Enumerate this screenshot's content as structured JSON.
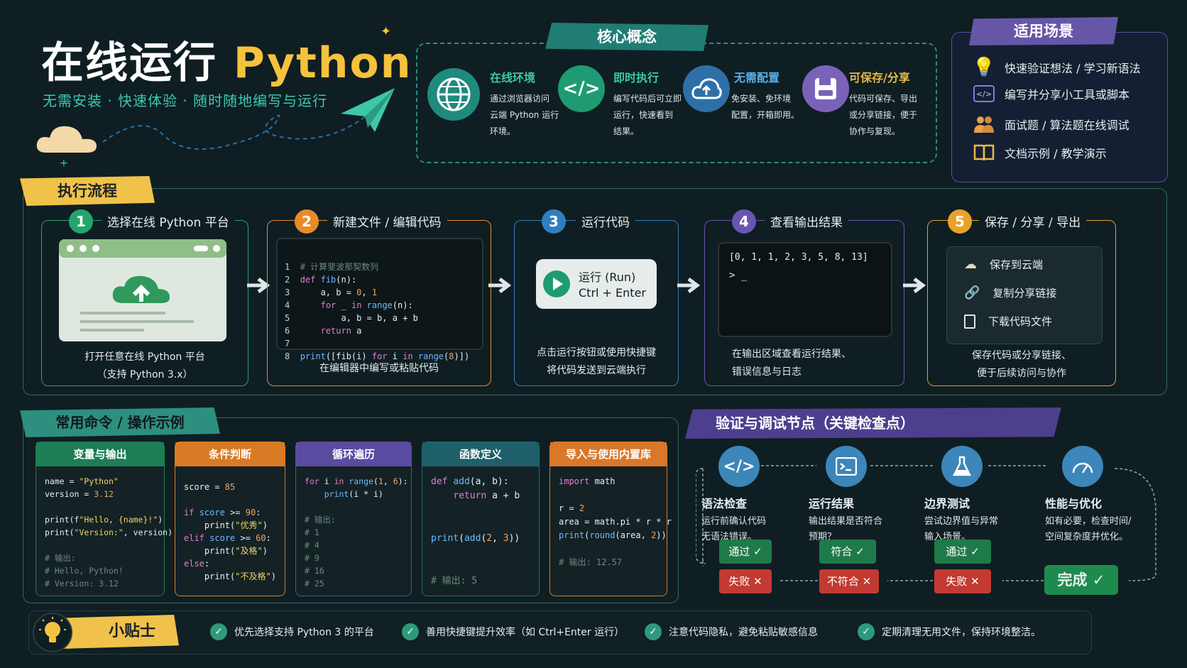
{
  "header": {
    "title_cn": "在线运行",
    "title_py": "Python",
    "subtitle": "无需安装 · 快速体验 · 随时随地编写与运行"
  },
  "concepts": {
    "banner": "核心概念",
    "items": [
      {
        "title": "在线环境",
        "desc": [
          "通过浏览器访问",
          "云端 Python 运行",
          "环境。"
        ],
        "icon": "globe-icon",
        "color": "#1f8a7e"
      },
      {
        "title": "即时执行",
        "desc": [
          "编写代码后可立即",
          "运行，快速看到",
          "结果。"
        ],
        "icon": "code-icon",
        "color": "#1f9a72"
      },
      {
        "title": "无需配置",
        "desc": [
          "免安装、免环境",
          "配置，开箱即用。"
        ],
        "icon": "cloud-icon",
        "color": "#2f6fa8"
      },
      {
        "title": "可保存/分享",
        "desc": [
          "代码可保存、导出",
          "或分享链接，便于",
          "协作与复现。"
        ],
        "icon": "save-icon",
        "color": "#7a62b8"
      }
    ]
  },
  "scenarios": {
    "banner": "适用场景",
    "items": [
      {
        "label": "快速验证想法 / 学习新语法",
        "icon": "lightbulb-icon"
      },
      {
        "label": "编写并分享小工具或脚本",
        "icon": "code-window-icon"
      },
      {
        "label": "面试题 / 算法题在线调试",
        "icon": "people-icon"
      },
      {
        "label": "文档示例 / 教学演示",
        "icon": "book-icon"
      }
    ]
  },
  "flow": {
    "banner": "执行流程",
    "steps": [
      {
        "num": "1",
        "title": "选择在线 Python 平台",
        "desc": [
          "打开任意在线 Python 平台",
          "（支持 Python 3.x）"
        ],
        "color": "#24a56b"
      },
      {
        "num": "2",
        "title": "新建文件 / 编辑代码",
        "desc": [
          "在编辑器中编写或粘贴代码"
        ],
        "color": "#e88a2a"
      },
      {
        "num": "3",
        "title": "运行代码",
        "desc": [
          "点击运行按钮或使用快捷键",
          "将代码发送到云端执行"
        ],
        "color": "#2f7fc0",
        "run_label": "运行 (Run)",
        "run_shortcut": "Ctrl + Enter"
      },
      {
        "num": "4",
        "title": "查看输出结果",
        "desc": [
          "在输出区域查看运行结果、",
          "错误信息与日志"
        ],
        "color": "#6a55b0",
        "output": "[0, 1, 1, 2, 3, 5, 8, 13]",
        "prompt": "> _"
      },
      {
        "num": "5",
        "title": "保存 / 分享 / 导出",
        "desc": [
          "保存代码或分享链接、",
          "便于后续访问与协作"
        ],
        "color": "#e8a22a",
        "actions": [
          "保存到云端",
          "复制分享链接",
          "下载代码文件"
        ]
      }
    ],
    "code_lines": [
      "# 计算斐波那契数列",
      "def fib(n):",
      "    a, b = 0, 1",
      "    for _ in range(n):",
      "        a, b = b, a + b",
      "    return a",
      "",
      "print([fib(i) for i in range(8)])"
    ]
  },
  "commands": {
    "banner": "常用命令 / 操作示例",
    "cards": [
      {
        "title": "变量与输出",
        "color": "#1f7d55"
      },
      {
        "title": "条件判断",
        "color": "#d97a24"
      },
      {
        "title": "循环遍历",
        "color": "#5b4ba0"
      },
      {
        "title": "函数定义",
        "color": "#1f6d78"
      },
      {
        "title": "导入与使用内置库",
        "color": "#d9772a"
      }
    ]
  },
  "verify": {
    "banner": "验证与调试节点（关键检查点）",
    "nodes": [
      {
        "title": "语法检查",
        "desc": [
          "运行前确认代码",
          "无语法错误。"
        ],
        "icon": "code-icon",
        "pass": "通过 ✓",
        "fail": "失败 ✕"
      },
      {
        "title": "运行结果",
        "desc": [
          "输出结果是否符合",
          "预期？"
        ],
        "icon": "terminal-icon",
        "pass": "符合 ✓",
        "fail": "不符合 ✕"
      },
      {
        "title": "边界测试",
        "desc": [
          "尝试边界值与异常",
          "输入场景。"
        ],
        "icon": "flask-icon",
        "pass": "通过 ✓",
        "fail": "失败 ✕"
      },
      {
        "title": "性能与优化",
        "desc": [
          "如有必要，检查时间/",
          "空间复杂度并优化。"
        ],
        "icon": "gauge-icon"
      }
    ],
    "done": "完成 ✓"
  },
  "tips": {
    "banner": "小贴士",
    "items": [
      "优先选择支持 Python 3 的平台",
      "善用快捷键提升效率（如 Ctrl+Enter 运行）",
      "注意代码隐私，避免粘贴敏感信息",
      "定期清理无用文件，保持环境整洁。"
    ]
  }
}
